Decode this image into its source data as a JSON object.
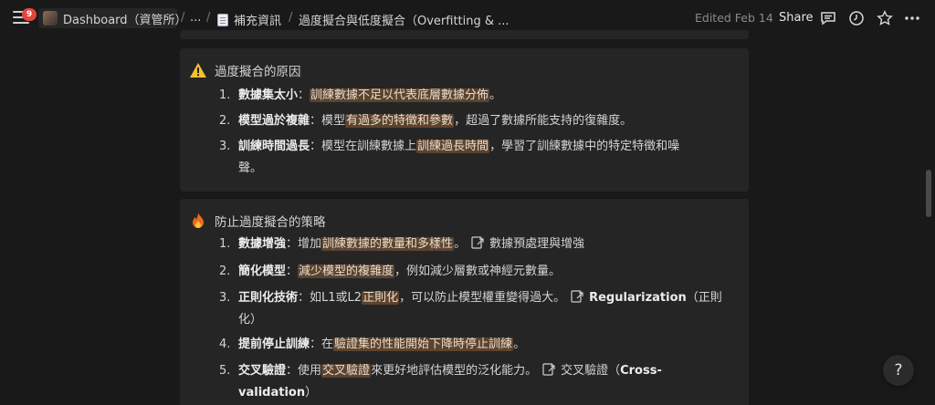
{
  "topbar": {
    "notification_count": "9",
    "workspace": "Dashboard（資管所）",
    "ellipsis": "...",
    "parent_page": "補充資訊",
    "current_page": "過度擬合與低度擬合（Overfitting & ...",
    "edited": "Edited Feb 14",
    "share": "Share"
  },
  "callout1": {
    "title": "過度擬合的原因",
    "icon": "warning-icon",
    "items": [
      {
        "num": "1.",
        "bold": "數據集太小",
        "colon": "：",
        "hl": "訓練數據不足以代表底層數據分佈",
        "rest": "。"
      },
      {
        "num": "2.",
        "bold": "模型過於複雜",
        "colon": "：",
        "pre": "模型",
        "hl": "有過多的特徵和參數",
        "rest": "，超過了數據所能支持的復雜度。"
      },
      {
        "num": "3.",
        "bold": "訓練時間過長",
        "colon": "：",
        "pre": "模型在訓練數據上",
        "hl": "訓練過長時間",
        "rest": "，學習了訓練數據中的特定特徵和噪",
        "rest2": "聲。"
      }
    ]
  },
  "callout2": {
    "title": "防止過度擬合的策略",
    "icon": "fire-icon",
    "items": [
      {
        "num": "1.",
        "bold": "數據增強",
        "colon": "：",
        "pre": "增加",
        "hl": "訓練數據的數量和多樣性",
        "rest": "。",
        "mention": "數據預處理與增強"
      },
      {
        "num": "2.",
        "bold": "簡化模型",
        "colon": "：",
        "hl": "減少模型的複雜度",
        "rest": "，例如減少層數或神經元數量。"
      },
      {
        "num": "3.",
        "bold": "正則化技術",
        "colon": "：",
        "pre": "如L1或L2",
        "hl": "正則化",
        "rest": "，可以防止模型權重變得過大。",
        "mention_bold": "Regularization",
        "mention_rest": "（正則",
        "rest2": "化）"
      },
      {
        "num": "4.",
        "bold": "提前停止訓練",
        "colon": "：",
        "pre": "在",
        "hl": "驗證集的性能開始下降時停止訓練",
        "rest": "。"
      },
      {
        "num": "5.",
        "bold": "交叉驗證",
        "colon": "：",
        "pre": "使用",
        "hl": "交叉驗證",
        "rest": "來更好地評估模型的泛化能力。",
        "mention": "交叉驗證（",
        "mention_bold": "Cross-",
        "rest2_bold": "validation",
        "rest2": "）"
      }
    ]
  },
  "help": "?",
  "colors": {
    "background": "#191919",
    "callout": "#252525",
    "highlight": "#5c4330",
    "badge": "#e0463e"
  }
}
